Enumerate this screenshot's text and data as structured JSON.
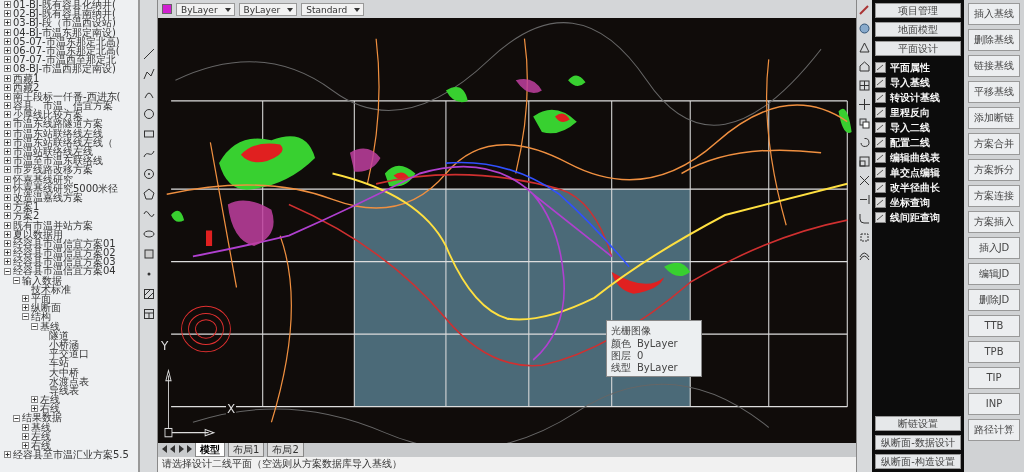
{
  "tree": [
    {
      "label": "01-BJ-既有容县化纳井(",
      "expanded": false
    },
    {
      "label": "02-BJ-既有容县南纳井(",
      "expanded": false
    },
    {
      "label": "03-BJ-段（市温西设站)",
      "expanded": false
    },
    {
      "label": "04-BJ-市温东那定南设)",
      "expanded": false
    },
    {
      "label": "05-07-市温东那定北高)",
      "expanded": false
    },
    {
      "label": "06-07-市温东那定北高(",
      "expanded": false
    },
    {
      "label": "07-07-市温西至那定北",
      "expanded": false
    },
    {
      "label": "08-BJ-市温西那定南设)",
      "expanded": false
    },
    {
      "label": "西藏1",
      "expanded": false
    },
    {
      "label": "西藏2",
      "expanded": false
    },
    {
      "label": "南王段标一仟番-西进东(",
      "expanded": false
    },
    {
      "label": "容县、市温、信宜方案",
      "expanded": false
    },
    {
      "label": "少厚线比较方案",
      "expanded": false
    },
    {
      "label": "市温东线路隧道方案",
      "expanded": false
    },
    {
      "label": "市温东站联络线左线",
      "expanded": false
    },
    {
      "label": "市温东站联络线左线（",
      "expanded": false
    },
    {
      "label": "市温站联络线左线",
      "expanded": false
    },
    {
      "label": "市温至市温东联络线",
      "expanded": false
    },
    {
      "label": "市罗线路改移方案",
      "expanded": false
    },
    {
      "label": "怀嘉基线研究",
      "expanded": false
    },
    {
      "label": "怀嘉基线研究5000米径",
      "expanded": false
    },
    {
      "label": "改造温嘉线方案",
      "expanded": false
    },
    {
      "label": "方案1",
      "expanded": false
    },
    {
      "label": "方案2",
      "expanded": false
    },
    {
      "label": "既有市温并站方案",
      "expanded": false
    },
    {
      "label": "夏以数据用",
      "expanded": false
    },
    {
      "label": "经容县市温信宜方案01",
      "expanded": false
    },
    {
      "label": "经容县市温信宜方案02",
      "expanded": false
    },
    {
      "label": "经容县市温信宜方案03",
      "expanded": false
    },
    {
      "label": "经容县市温信宜方案04",
      "expanded": true,
      "children": [
        {
          "label": "输入数据",
          "expanded": true,
          "children": [
            {
              "label": "技术标准"
            },
            {
              "label": "平面",
              "expanded": false
            },
            {
              "label": "纵断面",
              "expanded": false
            },
            {
              "label": "结构",
              "expanded": true,
              "children": [
                {
                  "label": "基线",
                  "expanded": true,
                  "children": [
                    {
                      "label": "隧道"
                    },
                    {
                      "label": "小桥涵"
                    },
                    {
                      "label": "平交道口"
                    },
                    {
                      "label": "车站"
                    },
                    {
                      "label": "大中桥"
                    },
                    {
                      "label": "水渡点表"
                    },
                    {
                      "label": "导线表"
                    }
                  ]
                },
                {
                  "label": "左线",
                  "expanded": false
                },
                {
                  "label": "右线",
                  "expanded": false
                }
              ]
            }
          ]
        },
        {
          "label": "结果数据",
          "expanded": true,
          "children": [
            {
              "label": "基线",
              "expanded": false
            },
            {
              "label": "左线",
              "expanded": false
            },
            {
              "label": "右线",
              "expanded": false
            }
          ]
        }
      ]
    },
    {
      "label": "经容县至市温汇业方案5.5",
      "expanded": false
    }
  ],
  "toolbar": {
    "dropdowns": [
      {
        "text": "ByLayer"
      },
      {
        "text": "ByLayer"
      },
      {
        "text": "Standard"
      }
    ]
  },
  "canvas": {
    "axis_x": "X",
    "axis_y": "Y",
    "popup": {
      "title": "光栅图像",
      "rows": [
        {
          "label": "颜色",
          "value": "ByLayer"
        },
        {
          "label": "图层",
          "value": "0"
        },
        {
          "label": "线型",
          "value": "ByLayer"
        }
      ]
    }
  },
  "layout_tabs": [
    {
      "label": "模型",
      "selected": true
    },
    {
      "label": "布局1",
      "selected": false
    },
    {
      "label": "布局2",
      "selected": false
    }
  ],
  "command_line": "请选择设计二线平面（空选则从方案数据库导入基线）",
  "tool_panel": {
    "header_buttons": [
      "项目管理",
      "地面模型",
      "平面设计"
    ],
    "items": [
      "平面属性",
      "导入基线",
      "转设计基线",
      "里程反向",
      "导入二线",
      "配置二线",
      "编辑曲线表",
      "单交点编辑",
      "改半径曲长",
      "坐标查询",
      "线间距查询"
    ],
    "footer_buttons": [
      "断链设置",
      "纵断面-数据设计",
      "纵断面-构造设置"
    ]
  },
  "side_buttons": [
    "插入基线",
    "删除基线",
    "链接基线",
    "平移基线",
    "添加断链",
    "方案合并",
    "方案拆分",
    "方案连接",
    "方案插入",
    "插入JD",
    "编辑JD",
    "删除JD",
    "TTB",
    "TPB",
    "TIP",
    "INP",
    "路径计算"
  ]
}
